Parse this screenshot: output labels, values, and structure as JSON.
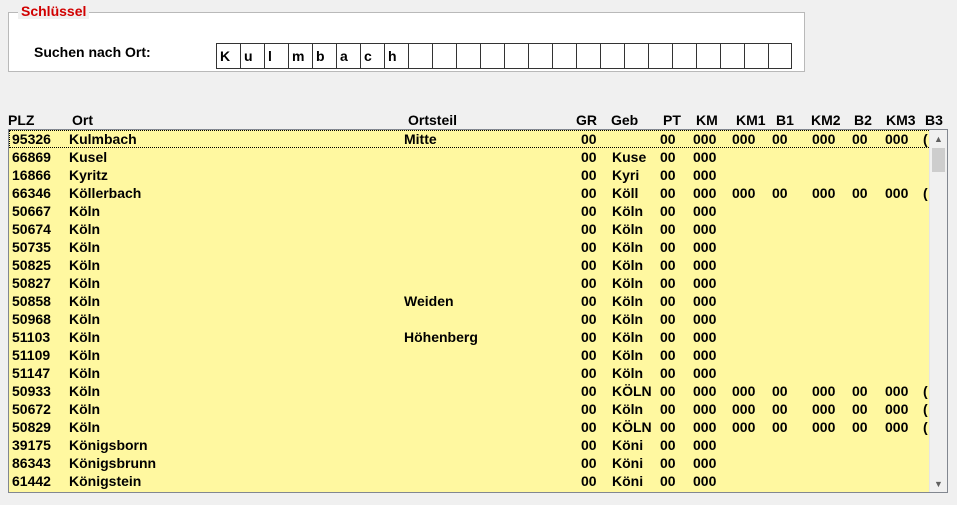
{
  "search_group": {
    "title": "Schlüssel",
    "label": "Suchen nach Ort:",
    "chars": [
      "K",
      "u",
      "l",
      "m",
      "b",
      "a",
      "c",
      "h",
      "",
      "",
      "",
      "",
      "",
      "",
      "",
      "",
      "",
      "",
      "",
      "",
      "",
      "",
      "",
      ""
    ]
  },
  "columns": [
    "PLZ",
    "Ort",
    "Ortsteil",
    "GR",
    "Geb",
    "PT",
    "KM",
    "KM1",
    "B1",
    "KM2",
    "B2",
    "KM3",
    "B3"
  ],
  "rows": [
    {
      "plz": "95326",
      "ort": "Kulmbach",
      "ortsteil": "Mitte",
      "gr": "00",
      "geb": "",
      "pt": "00",
      "km": "000",
      "km1": "000",
      "b1": "00",
      "km2": "000",
      "b2": "00",
      "km3": "000",
      "b3": "("
    },
    {
      "plz": "66869",
      "ort": "Kusel",
      "ortsteil": "",
      "gr": "00",
      "geb": "Kuse",
      "pt": "00",
      "km": "000",
      "km1": "",
      "b1": "",
      "km2": "",
      "b2": "",
      "km3": "",
      "b3": ""
    },
    {
      "plz": "16866",
      "ort": "Kyritz",
      "ortsteil": "",
      "gr": "00",
      "geb": "Kyri",
      "pt": "00",
      "km": "000",
      "km1": "",
      "b1": "",
      "km2": "",
      "b2": "",
      "km3": "",
      "b3": ""
    },
    {
      "plz": "66346",
      "ort": "Köllerbach",
      "ortsteil": "",
      "gr": "00",
      "geb": "Köll",
      "pt": "00",
      "km": "000",
      "km1": "000",
      "b1": "00",
      "km2": "000",
      "b2": "00",
      "km3": "000",
      "b3": "("
    },
    {
      "plz": "50667",
      "ort": "Köln",
      "ortsteil": "",
      "gr": "00",
      "geb": "Köln",
      "pt": "00",
      "km": "000",
      "km1": "",
      "b1": "",
      "km2": "",
      "b2": "",
      "km3": "",
      "b3": ""
    },
    {
      "plz": "50674",
      "ort": "Köln",
      "ortsteil": "",
      "gr": "00",
      "geb": "Köln",
      "pt": "00",
      "km": "000",
      "km1": "",
      "b1": "",
      "km2": "",
      "b2": "",
      "km3": "",
      "b3": ""
    },
    {
      "plz": "50735",
      "ort": "Köln",
      "ortsteil": "",
      "gr": "00",
      "geb": "Köln",
      "pt": "00",
      "km": "000",
      "km1": "",
      "b1": "",
      "km2": "",
      "b2": "",
      "km3": "",
      "b3": ""
    },
    {
      "plz": "50825",
      "ort": "Köln",
      "ortsteil": "",
      "gr": "00",
      "geb": "Köln",
      "pt": "00",
      "km": "000",
      "km1": "",
      "b1": "",
      "km2": "",
      "b2": "",
      "km3": "",
      "b3": ""
    },
    {
      "plz": "50827",
      "ort": "Köln",
      "ortsteil": "",
      "gr": "00",
      "geb": "Köln",
      "pt": "00",
      "km": "000",
      "km1": "",
      "b1": "",
      "km2": "",
      "b2": "",
      "km3": "",
      "b3": ""
    },
    {
      "plz": "50858",
      "ort": "Köln",
      "ortsteil": "Weiden",
      "gr": "00",
      "geb": "Köln",
      "pt": "00",
      "km": "000",
      "km1": "",
      "b1": "",
      "km2": "",
      "b2": "",
      "km3": "",
      "b3": ""
    },
    {
      "plz": "50968",
      "ort": "Köln",
      "ortsteil": "",
      "gr": "00",
      "geb": "Köln",
      "pt": "00",
      "km": "000",
      "km1": "",
      "b1": "",
      "km2": "",
      "b2": "",
      "km3": "",
      "b3": ""
    },
    {
      "plz": "51103",
      "ort": "Köln",
      "ortsteil": "Höhenberg",
      "gr": "00",
      "geb": "Köln",
      "pt": "00",
      "km": "000",
      "km1": "",
      "b1": "",
      "km2": "",
      "b2": "",
      "km3": "",
      "b3": ""
    },
    {
      "plz": "51109",
      "ort": "Köln",
      "ortsteil": "",
      "gr": "00",
      "geb": "Köln",
      "pt": "00",
      "km": "000",
      "km1": "",
      "b1": "",
      "km2": "",
      "b2": "",
      "km3": "",
      "b3": ""
    },
    {
      "plz": "51147",
      "ort": "Köln",
      "ortsteil": "",
      "gr": "00",
      "geb": "Köln",
      "pt": "00",
      "km": "000",
      "km1": "",
      "b1": "",
      "km2": "",
      "b2": "",
      "km3": "",
      "b3": ""
    },
    {
      "plz": "50933",
      "ort": "Köln",
      "ortsteil": "",
      "gr": "00",
      "geb": "KÖLN",
      "pt": "00",
      "km": "000",
      "km1": "000",
      "b1": "00",
      "km2": "000",
      "b2": "00",
      "km3": "000",
      "b3": "("
    },
    {
      "plz": "50672",
      "ort": "Köln",
      "ortsteil": "",
      "gr": "00",
      "geb": "Köln",
      "pt": "00",
      "km": "000",
      "km1": "000",
      "b1": "00",
      "km2": "000",
      "b2": "00",
      "km3": "000",
      "b3": "("
    },
    {
      "plz": "50829",
      "ort": "Köln",
      "ortsteil": "",
      "gr": "00",
      "geb": "KÖLN",
      "pt": "00",
      "km": "000",
      "km1": "000",
      "b1": "00",
      "km2": "000",
      "b2": "00",
      "km3": "000",
      "b3": "("
    },
    {
      "plz": "39175",
      "ort": "Königsborn",
      "ortsteil": "",
      "gr": "00",
      "geb": "Köni",
      "pt": "00",
      "km": "000",
      "km1": "",
      "b1": "",
      "km2": "",
      "b2": "",
      "km3": "",
      "b3": ""
    },
    {
      "plz": "86343",
      "ort": "Königsbrunn",
      "ortsteil": "",
      "gr": "00",
      "geb": "Köni",
      "pt": "00",
      "km": "000",
      "km1": "",
      "b1": "",
      "km2": "",
      "b2": "",
      "km3": "",
      "b3": ""
    },
    {
      "plz": "61442",
      "ort": "Königstein",
      "ortsteil": "",
      "gr": "00",
      "geb": "Köni",
      "pt": "00",
      "km": "000",
      "km1": "",
      "b1": "",
      "km2": "",
      "b2": "",
      "km3": "",
      "b3": ""
    }
  ],
  "colors": {
    "grid_bg": "#fff8a0",
    "legend": "#d10000"
  }
}
